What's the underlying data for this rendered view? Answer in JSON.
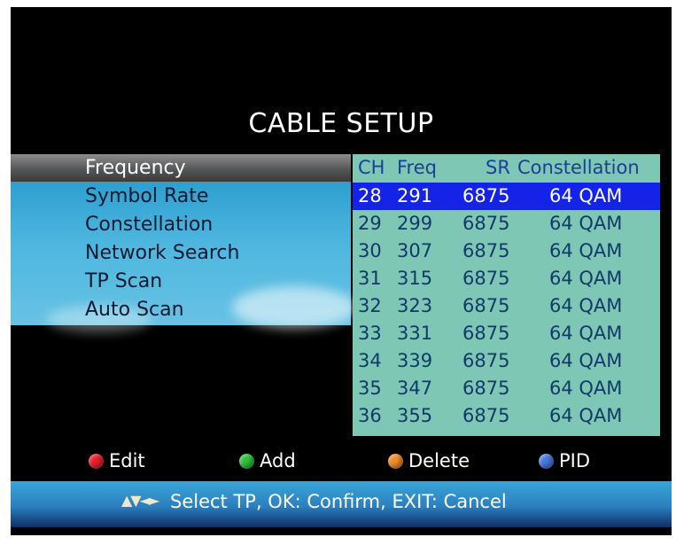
{
  "title": "CABLE SETUP",
  "menu": {
    "items": [
      {
        "label": "Frequency",
        "selected": true
      },
      {
        "label": "Symbol Rate",
        "selected": false
      },
      {
        "label": "Constellation",
        "selected": false
      },
      {
        "label": "Network Search",
        "selected": false
      },
      {
        "label": "TP Scan",
        "selected": false
      },
      {
        "label": "Auto Scan",
        "selected": false
      }
    ]
  },
  "tp_table": {
    "columns": [
      "CH",
      "Freq",
      "SR",
      "Constellation"
    ],
    "rows": [
      {
        "ch": "28",
        "freq": "291",
        "sr": "6875",
        "con": "64 QAM",
        "selected": true
      },
      {
        "ch": "29",
        "freq": "299",
        "sr": "6875",
        "con": "64 QAM",
        "selected": false
      },
      {
        "ch": "30",
        "freq": "307",
        "sr": "6875",
        "con": "64 QAM",
        "selected": false
      },
      {
        "ch": "31",
        "freq": "315",
        "sr": "6875",
        "con": "64 QAM",
        "selected": false
      },
      {
        "ch": "32",
        "freq": "323",
        "sr": "6875",
        "con": "64 QAM",
        "selected": false
      },
      {
        "ch": "33",
        "freq": "331",
        "sr": "6875",
        "con": "64 QAM",
        "selected": false
      },
      {
        "ch": "34",
        "freq": "339",
        "sr": "6875",
        "con": "64 QAM",
        "selected": false
      },
      {
        "ch": "35",
        "freq": "347",
        "sr": "6875",
        "con": "64 QAM",
        "selected": false
      },
      {
        "ch": "36",
        "freq": "355",
        "sr": "6875",
        "con": "64 QAM",
        "selected": false
      }
    ]
  },
  "legend": {
    "edit": {
      "label": "Edit",
      "color": "#e8202a",
      "icon": "red-dot-icon"
    },
    "add": {
      "label": "Add",
      "color": "#2fbf3a",
      "icon": "green-dot-icon"
    },
    "delete": {
      "label": "Delete",
      "color": "#f08a2a",
      "icon": "orange-dot-icon"
    },
    "pid": {
      "label": "PID",
      "color": "#4a78e0",
      "icon": "blue-dot-icon"
    }
  },
  "status": {
    "arrows_icon": "direction-arrows-icon",
    "text": "Select TP, OK: Confirm, EXIT: Cancel"
  },
  "colors": {
    "screen_bg": "#000000",
    "panel_bg": "#7ec7b4",
    "selected_row": "#1523e8",
    "header_text": "#1a3f9a"
  }
}
